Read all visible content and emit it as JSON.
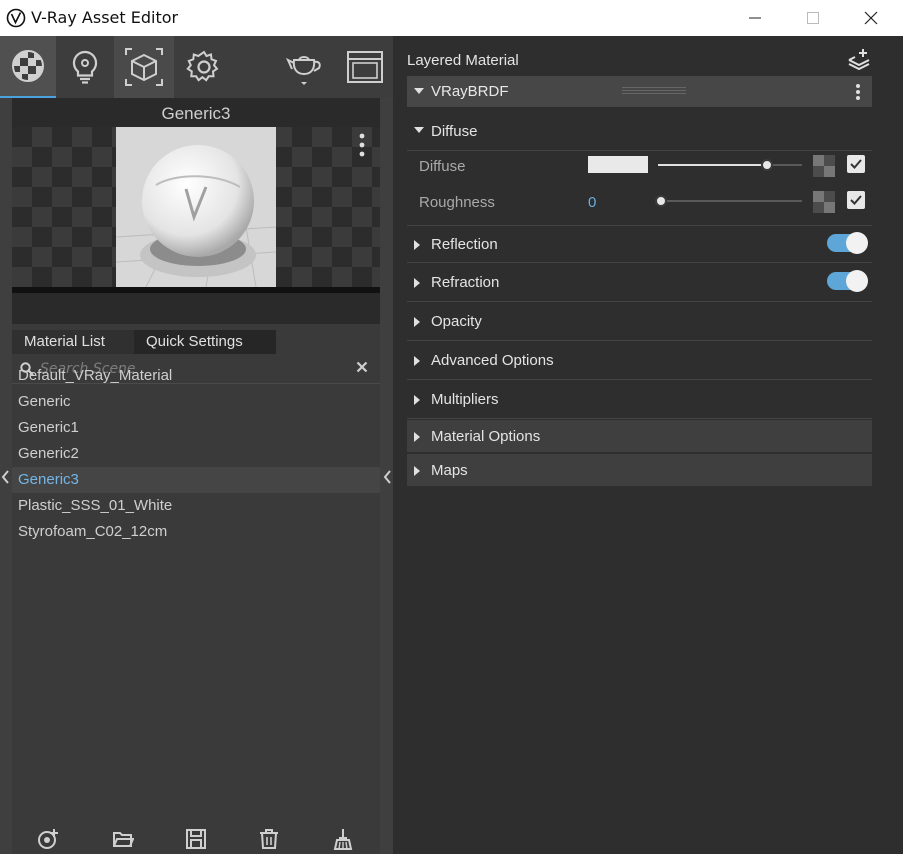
{
  "window": {
    "title": "V-Ray Asset Editor",
    "minimize_icon": "minimize-icon",
    "maximize_icon": "maximize-icon",
    "close_icon": "close-icon"
  },
  "toolbar": {
    "items": [
      {
        "name": "materials-tab",
        "icon": "material-sphere-icon"
      },
      {
        "name": "lights-tab",
        "icon": "lightbulb-icon"
      },
      {
        "name": "geometry-tab",
        "icon": "cube-icon"
      },
      {
        "name": "settings-tab",
        "icon": "gear-icon"
      },
      {
        "name": "render-button",
        "icon": "teapot-icon"
      },
      {
        "name": "frame-buffer-button",
        "icon": "frame-buffer-icon"
      }
    ]
  },
  "preview": {
    "material_name": "Generic3"
  },
  "left_tabs": {
    "material_list": "Material List",
    "quick_settings": "Quick Settings"
  },
  "search": {
    "placeholder": "Search Scene"
  },
  "materials": [
    {
      "label": "Default_VRay_Material",
      "selected": false
    },
    {
      "label": "Generic",
      "selected": false
    },
    {
      "label": "Generic1",
      "selected": false
    },
    {
      "label": "Generic2",
      "selected": false
    },
    {
      "label": "Generic3",
      "selected": true
    },
    {
      "label": "Plastic_SSS_01_White",
      "selected": false
    },
    {
      "label": "Styrofoam_C02_12cm",
      "selected": false
    }
  ],
  "bottom_bar": [
    "add-material-icon",
    "open-folder-icon",
    "save-icon",
    "delete-icon",
    "purge-icon"
  ],
  "editor": {
    "layer_title": "Layered Material",
    "brdf_label": "VRayBRDF",
    "diffuse_section": "Diffuse",
    "params": {
      "diffuse_label": "Diffuse",
      "diffuse_color": "#e9e9e9",
      "diffuse_amount": 0.76,
      "diffuse_enabled": true,
      "roughness_label": "Roughness",
      "roughness_value": "0",
      "roughness_amount": 0.0,
      "roughness_enabled": true
    },
    "sections": {
      "reflection": "Reflection",
      "reflection_on": true,
      "refraction": "Refraction",
      "refraction_on": true,
      "opacity": "Opacity",
      "advanced": "Advanced Options",
      "multipliers": "Multipliers",
      "material_options": "Material Options",
      "maps": "Maps"
    }
  },
  "colors": {
    "accent": "#5ea6d8",
    "selected_text": "#74b6e6",
    "panel_bg": "#2e2e2e"
  }
}
